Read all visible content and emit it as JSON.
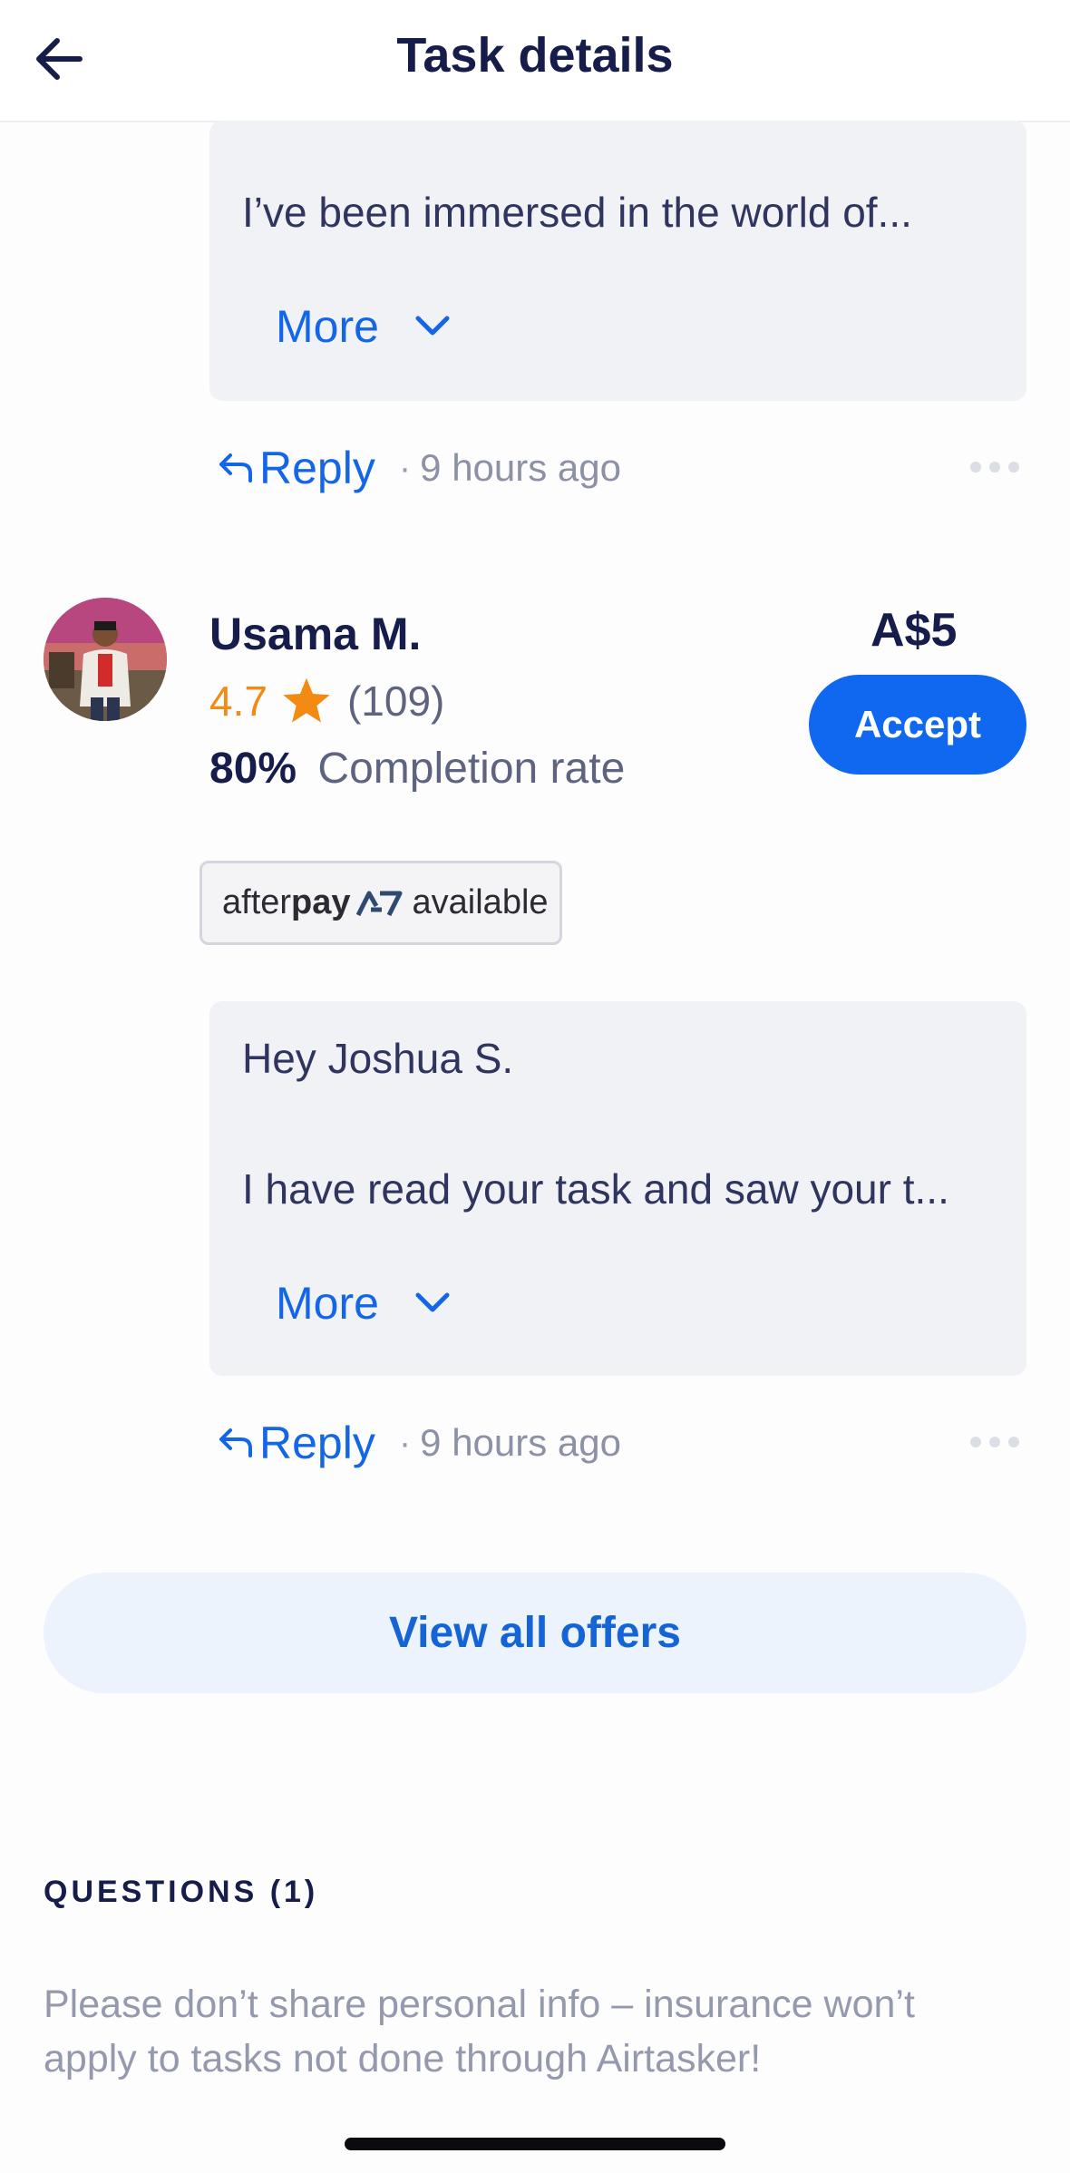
{
  "header": {
    "title": "Task details",
    "back_icon": "arrow-left-icon"
  },
  "offers": [
    {
      "message_preview": "I’ve been immersed in the world of...",
      "more_label": "More",
      "reply_label": "Reply",
      "separator": "·",
      "time_ago": "9 hours ago"
    },
    {
      "name": "Usama M.",
      "rating": "4.7",
      "review_count": "(109)",
      "completion_percent": "80%",
      "completion_label": "Completion rate",
      "price": "A$5",
      "accept_label": "Accept",
      "afterpay": {
        "brand_light": "after",
        "brand_bold": "pay",
        "available_label": "available"
      },
      "message_greeting": "Hey Joshua S.",
      "message_preview": "I have read your task and saw your t...",
      "more_label": "More",
      "reply_label": "Reply",
      "separator": "·",
      "time_ago": "9 hours ago"
    }
  ],
  "view_all_offers_label": "View all offers",
  "questions": {
    "heading": "QUESTIONS (1)",
    "notice": "Please don’t share personal info – insurance won’t apply to tasks not done through Airtasker!"
  },
  "colors": {
    "primary": "#0f68ef",
    "link": "#1366e7",
    "rating": "#f28a13",
    "navy": "#161d4b"
  }
}
